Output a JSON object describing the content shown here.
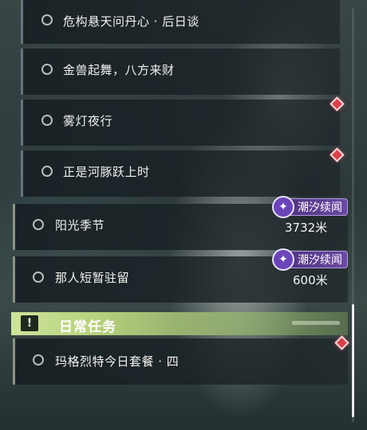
{
  "quests": [
    {
      "label": "危构悬天问丹心 · 后日谈"
    },
    {
      "label": "金兽起舞，八方来财"
    },
    {
      "label": "雾灯夜行"
    },
    {
      "label": "正是河豚跃上时"
    },
    {
      "label": "阳光季节",
      "badge": "潮汐续闻",
      "distance": "3732米"
    },
    {
      "label": "那人短暂驻留",
      "badge": "潮汐续闻",
      "distance": "600米"
    }
  ],
  "daily_section": {
    "icon": "!",
    "title": "日常任务",
    "items": [
      {
        "label": "玛格烈特今日套餐 · 四"
      }
    ]
  },
  "colors": {
    "tracked_marker": "#d9404a",
    "badge_purple": "#6a4aa3",
    "section_green": "#cde39a"
  },
  "icons": {
    "quest_radio": "radio-circle",
    "tracked_marker": "red-diamond-marker",
    "badge": "tidal-sparkle-icon",
    "section": "exclamation-icon"
  }
}
